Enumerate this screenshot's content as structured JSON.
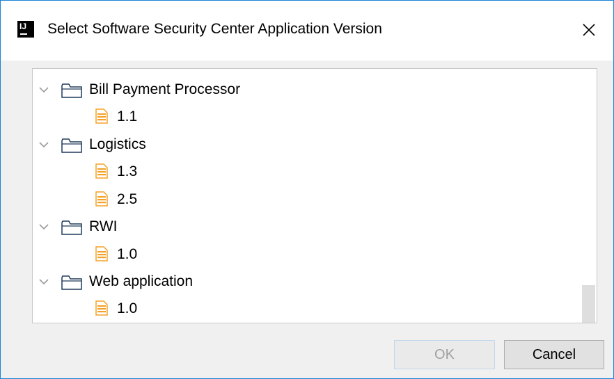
{
  "window": {
    "title": "Select Software Security Center Application Version",
    "app_icon_text": "IJ",
    "close_glyph": "✕"
  },
  "tree": {
    "items": [
      {
        "kind": "folder",
        "label": "Bill Payment Processor",
        "expanded": true
      },
      {
        "kind": "file",
        "label": "1.1"
      },
      {
        "kind": "folder",
        "label": "Logistics",
        "expanded": true
      },
      {
        "kind": "file",
        "label": "1.3"
      },
      {
        "kind": "file",
        "label": "2.5"
      },
      {
        "kind": "folder",
        "label": "RWI",
        "expanded": true
      },
      {
        "kind": "file",
        "label": "1.0"
      },
      {
        "kind": "folder",
        "label": "Web application",
        "expanded": true
      },
      {
        "kind": "file",
        "label": "1.0"
      }
    ]
  },
  "buttons": {
    "ok_label": "OK",
    "ok_enabled": false,
    "cancel_label": "Cancel"
  },
  "colors": {
    "window_border": "#1883d7",
    "folder_stroke": "#1f3a5a",
    "file_fill": "#f5a22a",
    "chevron": "#9a9a9a"
  },
  "icons": {
    "folder": "folder-icon",
    "file": "file-icon",
    "chevron": "chevron-down-icon",
    "close": "close-icon",
    "app": "intellij-app-icon"
  }
}
